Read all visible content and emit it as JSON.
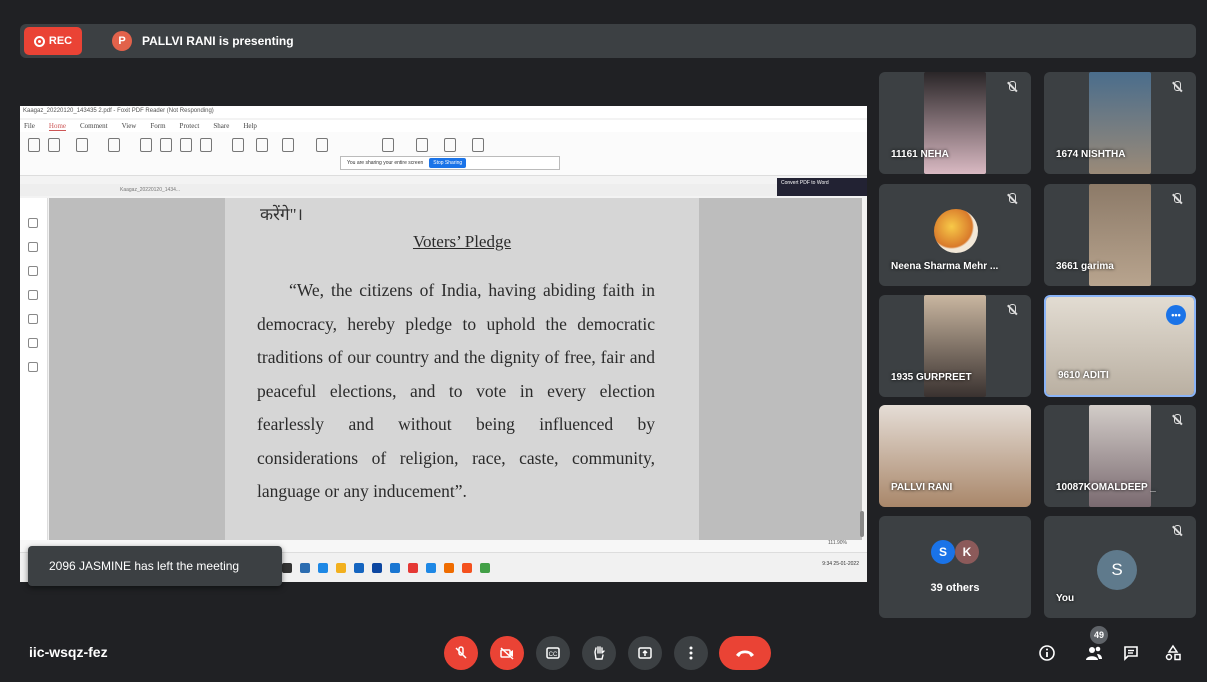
{
  "recording": {
    "label": "REC"
  },
  "presenter": {
    "initial": "P",
    "text": "PALLVI RANI is presenting"
  },
  "shared_screen": {
    "window_title": "Kaagaz_20220120_143435 2.pdf - Foxit PDF Reader (Not Responding)",
    "menu": [
      "File",
      "Home",
      "Comment",
      "View",
      "Form",
      "Protect",
      "Share",
      "Help"
    ],
    "active_menu": "Home",
    "share_notice": "You are sharing your entire screen",
    "stop_sharing": "Stop Sharing",
    "tab_label": "Kaagaz_20220120_1434...",
    "convert_label": "Convert PDF to Word",
    "hindi_line": "करेंगे\"।",
    "pledge_title": "Voters’ Pledge",
    "pledge_text": "“We, the citizens of India, having abiding faith in democracy, hereby pledge to uphold the democratic traditions of our country and the dignity of free, fair and peaceful elections, and to vote in every election fearlessly and without being influenced by considerations of religion, race, caste, community, language or any inducement”.",
    "zoom": "111.90%",
    "clock": "9:34",
    "date": "25-01-2022"
  },
  "toast": "2096 JASMINE has left the meeting",
  "participants": [
    {
      "name": "11161 NEHA",
      "muted": true,
      "color": "#d9b9c2"
    },
    {
      "name": "1674 NISHTHA",
      "muted": true,
      "color": "#9a8a78"
    },
    {
      "name": "Neena Sharma Mehr ...",
      "muted": true,
      "color": "#3c4043"
    },
    {
      "name": "3661 garima",
      "muted": true,
      "color": "#b8a48e"
    },
    {
      "name": "1935 GURPREET",
      "muted": true,
      "color": "#6b5a4a"
    },
    {
      "name": "9610 ADITI",
      "muted": false,
      "speaking": true,
      "color": "#c8c0b4"
    },
    {
      "name": "PALLVI RANI",
      "muted": false,
      "color": "#a9876a"
    },
    {
      "name": "10087KOMALDEEP _",
      "muted": true,
      "color": "#b4aeb0"
    },
    {
      "name": "39 others",
      "muted": false,
      "color": "#3c4043"
    },
    {
      "name": "You",
      "muted": true,
      "color": "#3c4043"
    }
  ],
  "others": {
    "initials": [
      "S",
      "K"
    ],
    "colors": [
      "#1a73e8",
      "#8c5a5a"
    ],
    "label": "39 others"
  },
  "you": {
    "initial": "S",
    "label": "You"
  },
  "meeting_code": "iic-wsqz-fez",
  "people_count": "49",
  "icons": {
    "mic": "mic-off-icon",
    "cam": "camera-off-icon",
    "cc": "captions-icon",
    "hand": "raise-hand-icon",
    "present": "present-icon",
    "more": "more-vert-icon",
    "end": "call-end-icon",
    "info": "info-icon",
    "people": "people-icon",
    "chat": "chat-icon",
    "activities": "activities-icon"
  }
}
